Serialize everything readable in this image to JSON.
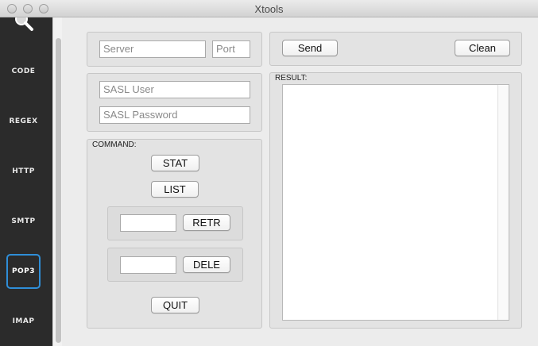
{
  "window": {
    "title": "Xtools"
  },
  "sidebar": {
    "items": [
      {
        "label": "CODE"
      },
      {
        "label": "REGEX"
      },
      {
        "label": "HTTP"
      },
      {
        "label": "SMTP"
      },
      {
        "label": "POP3",
        "active": true
      },
      {
        "label": "IMAP"
      }
    ]
  },
  "server": {
    "server_placeholder": "Server",
    "port_placeholder": "Port"
  },
  "sasl": {
    "user_placeholder": "SASL User",
    "password_placeholder": "SASL Password"
  },
  "command": {
    "label": "COMMAND:",
    "stat": "STAT",
    "list": "LIST",
    "retr": "RETR",
    "dele": "DELE",
    "quit": "QUIT",
    "retr_value": "",
    "dele_value": ""
  },
  "actions": {
    "send": "Send",
    "clean": "Clean"
  },
  "result": {
    "label": "RESULT:",
    "text": ""
  },
  "colors": {
    "sidebar_bg": "#2b2b2b",
    "active_border": "#2f8ed8"
  }
}
